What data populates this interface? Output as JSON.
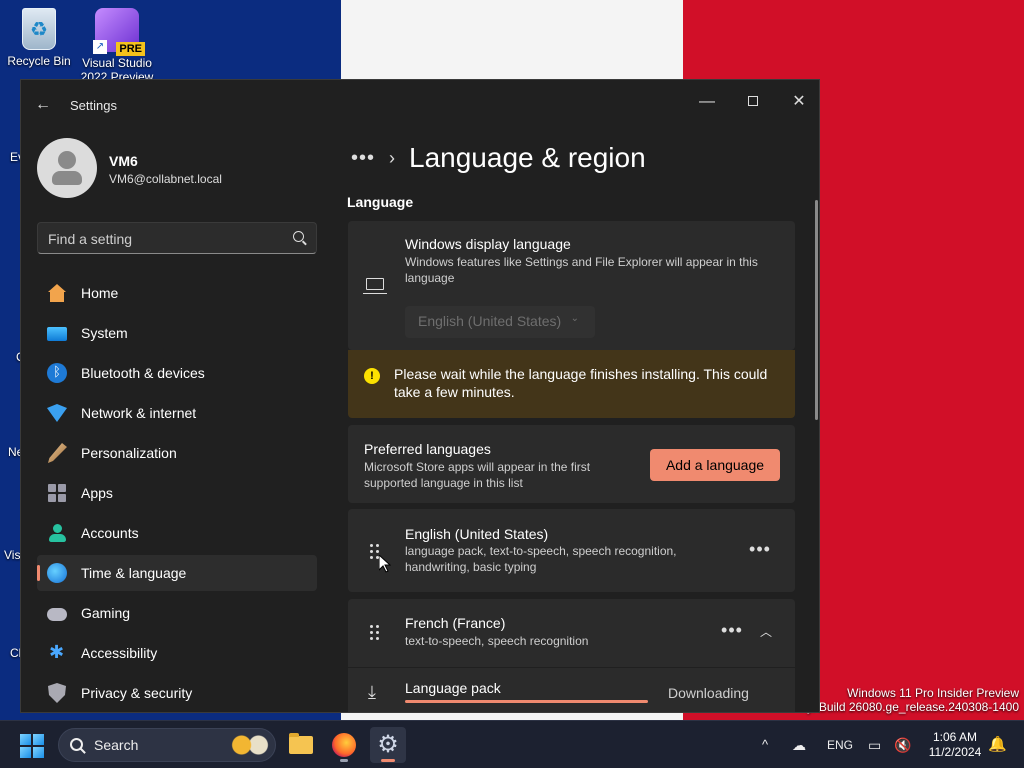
{
  "desktop": {
    "icons": [
      {
        "label": "Recycle Bin"
      },
      {
        "label": "Visual Studio 2022 Preview",
        "badge": "PRE"
      }
    ],
    "edge_labels": [
      "Ev",
      "Ne",
      "C",
      "Vis",
      "Cl"
    ],
    "watermark": {
      "line1": "Windows 11 Pro Insider Preview",
      "line2": "y. Build 26080.ge_release.240308-1400"
    },
    "wallpaper_colors": {
      "blue": "#0b2c80",
      "white": "#f4f4f4",
      "red": "#d10f28"
    }
  },
  "window": {
    "title": "Settings",
    "controls": {
      "minimize": "—",
      "close": "✕"
    },
    "accent_color": "#f08a6f"
  },
  "profile": {
    "name": "VM6",
    "email": "VM6@collabnet.local"
  },
  "search": {
    "placeholder": "Find a setting"
  },
  "nav": {
    "items": [
      {
        "label": "Home",
        "icon": "home-icon"
      },
      {
        "label": "System",
        "icon": "system-icon"
      },
      {
        "label": "Bluetooth & devices",
        "icon": "bluetooth-icon"
      },
      {
        "label": "Network & internet",
        "icon": "network-icon"
      },
      {
        "label": "Personalization",
        "icon": "brush-icon"
      },
      {
        "label": "Apps",
        "icon": "apps-icon"
      },
      {
        "label": "Accounts",
        "icon": "accounts-icon"
      },
      {
        "label": "Time & language",
        "icon": "globe-clock-icon",
        "active": true
      },
      {
        "label": "Gaming",
        "icon": "gamepad-icon"
      },
      {
        "label": "Accessibility",
        "icon": "accessibility-icon"
      },
      {
        "label": "Privacy & security",
        "icon": "shield-icon"
      }
    ]
  },
  "main": {
    "breadcrumb_more": "•••",
    "breadcrumb_sep": "›",
    "title": "Language & region",
    "section_language": "Language",
    "display_language": {
      "title": "Windows display language",
      "description": "Windows features like Settings and File Explorer will appear in this language",
      "selected": "English (United States)",
      "chevron": "⌄"
    },
    "warning": {
      "icon_glyph": "!",
      "text": "Please wait while the language finishes installing. This could take a few minutes."
    },
    "preferred": {
      "title": "Preferred languages",
      "description": "Microsoft Store apps will appear in the first supported language in this list",
      "button": "Add a language"
    },
    "languages": [
      {
        "name": "English (United States)",
        "features": "language pack, text-to-speech, speech recognition, handwriting, basic typing",
        "more": "•••"
      },
      {
        "name": "French (France)",
        "features": "text-to-speech, speech recognition",
        "more": "•••",
        "expand_glyph": "︿"
      }
    ],
    "language_pack": {
      "label": "Language pack",
      "status": "Downloading",
      "progress": 1.0,
      "download_glyph": "⤓"
    }
  },
  "taskbar": {
    "search_label": "Search",
    "tray": {
      "chevron": "^",
      "language": "ENG",
      "time": "1:06 AM",
      "date": "11/2/2024"
    }
  }
}
